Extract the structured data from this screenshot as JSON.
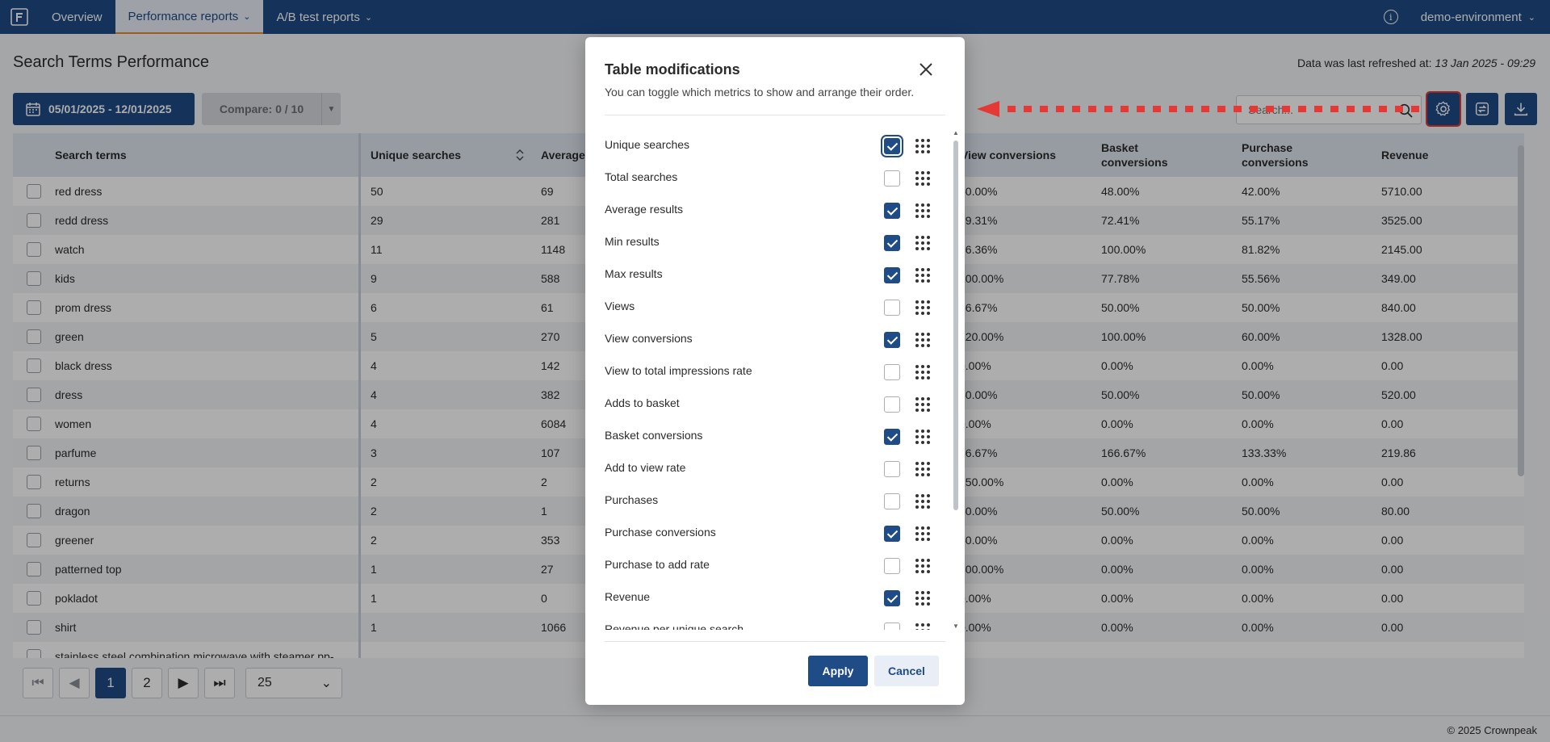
{
  "nav": {
    "items": [
      {
        "label": "Overview",
        "active": false,
        "dropdown": false
      },
      {
        "label": "Performance reports",
        "active": true,
        "dropdown": true
      },
      {
        "label": "A/B test reports",
        "active": false,
        "dropdown": true
      }
    ],
    "environment": "demo-environment",
    "info_icon": "info-icon"
  },
  "page": {
    "title": "Search Terms Performance",
    "refresh_label": "Data was last refreshed at:",
    "refresh_value": "13 Jan 2025 - 09:29",
    "date_range": "05/01/2025 - 12/01/2025",
    "compare_label": "Compare: 0 / 10",
    "search_placeholder": "Search..."
  },
  "table": {
    "columns": [
      "Search terms",
      "Unique searches",
      "Average",
      "View conversions",
      "Basket conversions",
      "Purchase conversions",
      "Revenue"
    ],
    "rows": [
      {
        "term": "red dress",
        "unique": "50",
        "avg": "69",
        "view": "60.00%",
        "basket": "48.00%",
        "purchase": "42.00%",
        "revenue": "5710.00"
      },
      {
        "term": "redd dress",
        "unique": "29",
        "avg": "281",
        "view": "79.31%",
        "basket": "72.41%",
        "purchase": "55.17%",
        "revenue": "3525.00"
      },
      {
        "term": "watch",
        "unique": "11",
        "avg": "1148",
        "view": "36.36%",
        "basket": "100.00%",
        "purchase": "81.82%",
        "revenue": "2145.00"
      },
      {
        "term": "kids",
        "unique": "9",
        "avg": "588",
        "view": "100.00%",
        "basket": "77.78%",
        "purchase": "55.56%",
        "revenue": "349.00"
      },
      {
        "term": "prom dress",
        "unique": "6",
        "avg": "61",
        "view": "66.67%",
        "basket": "50.00%",
        "purchase": "50.00%",
        "revenue": "840.00"
      },
      {
        "term": "green",
        "unique": "5",
        "avg": "270",
        "view": "120.00%",
        "basket": "100.00%",
        "purchase": "60.00%",
        "revenue": "1328.00"
      },
      {
        "term": "black dress",
        "unique": "4",
        "avg": "142",
        "view": "0.00%",
        "basket": "0.00%",
        "purchase": "0.00%",
        "revenue": "0.00"
      },
      {
        "term": "dress",
        "unique": "4",
        "avg": "382",
        "view": "50.00%",
        "basket": "50.00%",
        "purchase": "50.00%",
        "revenue": "520.00"
      },
      {
        "term": "women",
        "unique": "4",
        "avg": "6084",
        "view": "0.00%",
        "basket": "0.00%",
        "purchase": "0.00%",
        "revenue": "0.00"
      },
      {
        "term": "parfume",
        "unique": "3",
        "avg": "107",
        "view": "66.67%",
        "basket": "166.67%",
        "purchase": "133.33%",
        "revenue": "219.86"
      },
      {
        "term": "returns",
        "unique": "2",
        "avg": "2",
        "view": "150.00%",
        "basket": "0.00%",
        "purchase": "0.00%",
        "revenue": "0.00"
      },
      {
        "term": "dragon",
        "unique": "2",
        "avg": "1",
        "view": "50.00%",
        "basket": "50.00%",
        "purchase": "50.00%",
        "revenue": "80.00"
      },
      {
        "term": "greener",
        "unique": "2",
        "avg": "353",
        "view": "50.00%",
        "basket": "0.00%",
        "purchase": "0.00%",
        "revenue": "0.00"
      },
      {
        "term": "patterned top",
        "unique": "1",
        "avg": "27",
        "view": "300.00%",
        "basket": "0.00%",
        "purchase": "0.00%",
        "revenue": "0.00"
      },
      {
        "term": "pokladot",
        "unique": "1",
        "avg": "0",
        "view": "0.00%",
        "basket": "0.00%",
        "purchase": "0.00%",
        "revenue": "0.00"
      },
      {
        "term": "shirt",
        "unique": "1",
        "avg": "1066",
        "view": "0.00%",
        "basket": "0.00%",
        "purchase": "0.00%",
        "revenue": "0.00"
      },
      {
        "term": "stainless steel combination microwave with steamer pp-",
        "unique": "",
        "avg": "",
        "view": "",
        "basket": "",
        "purchase": "",
        "revenue": ""
      }
    ]
  },
  "pagination": {
    "pages": [
      "1",
      "2"
    ],
    "current": "1",
    "page_size": "25"
  },
  "footer": {
    "copyright": "© 2025 Crownpeak"
  },
  "modal": {
    "title": "Table modifications",
    "subtitle": "You can toggle which metrics to show and arrange their order.",
    "apply": "Apply",
    "cancel": "Cancel",
    "metrics": [
      {
        "label": "Unique searches",
        "checked": true
      },
      {
        "label": "Total searches",
        "checked": false
      },
      {
        "label": "Average results",
        "checked": true
      },
      {
        "label": "Min results",
        "checked": true
      },
      {
        "label": "Max results",
        "checked": true
      },
      {
        "label": "Views",
        "checked": false
      },
      {
        "label": "View conversions",
        "checked": true
      },
      {
        "label": "View to total impressions rate",
        "checked": false
      },
      {
        "label": "Adds to basket",
        "checked": false
      },
      {
        "label": "Basket conversions",
        "checked": true
      },
      {
        "label": "Add to view rate",
        "checked": false
      },
      {
        "label": "Purchases",
        "checked": false
      },
      {
        "label": "Purchase conversions",
        "checked": true
      },
      {
        "label": "Purchase to add rate",
        "checked": false
      },
      {
        "label": "Revenue",
        "checked": true
      },
      {
        "label": "Revenue per unique search",
        "checked": false
      }
    ]
  },
  "colors": {
    "primary": "#1f4b87",
    "accent_tab": "#e88b2e",
    "annotation": "#e53935"
  }
}
